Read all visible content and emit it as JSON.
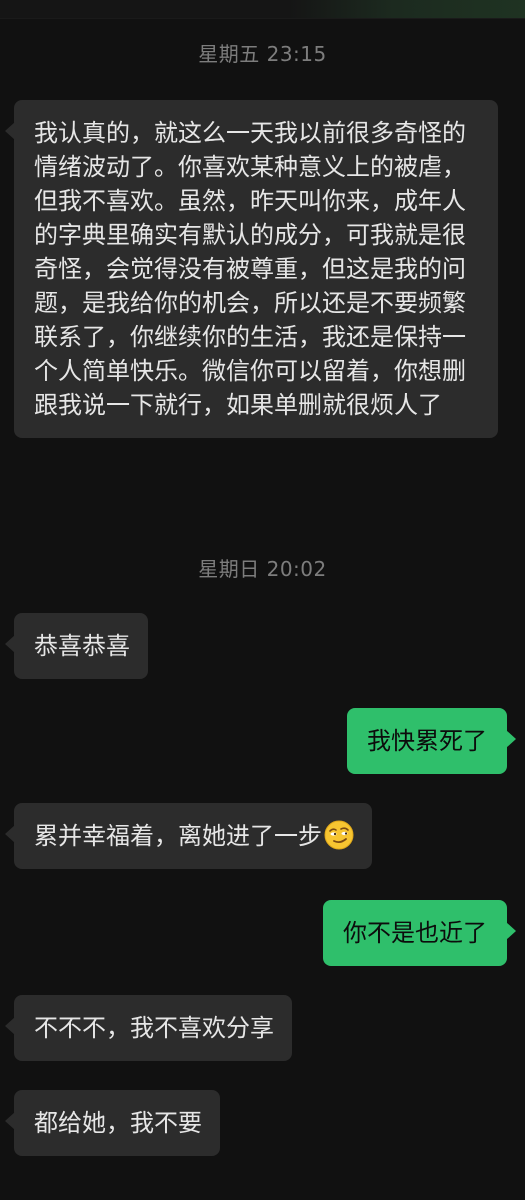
{
  "chat": {
    "timestamps": [
      "星期五 23:15",
      "星期日 20:02"
    ],
    "messages": [
      {
        "side": "in",
        "text": "我认真的，就这么一天我以前很多奇怪的情绪波动了。你喜欢某种意义上的被虐，但我不喜欢。虽然，昨天叫你来，成年人的字典里确实有默认的成分，可我就是很奇怪，会觉得没有被尊重，但这是我的问题，是我给你的机会，所以还是不要频繁联系了，你继续你的生活，我还是保持一个人简单快乐。微信你可以留着，你想删跟我说一下就行，如果单删就很烦人了"
      },
      {
        "side": "in",
        "text": "恭喜恭喜"
      },
      {
        "side": "out",
        "text": "我快累死了"
      },
      {
        "side": "in",
        "text": "累并幸福着，离她进了一步",
        "emoji": "smirk-emoji"
      },
      {
        "side": "out",
        "text": "你不是也近了"
      },
      {
        "side": "in",
        "text": "不不不，我不喜欢分享"
      },
      {
        "side": "in",
        "text": "都给她，我不要"
      }
    ]
  },
  "colors": {
    "background": "#111111",
    "incoming_bubble": "#2c2c2c",
    "outgoing_bubble": "#2fbf6b",
    "timestamp_text": "#7d7d7d"
  }
}
